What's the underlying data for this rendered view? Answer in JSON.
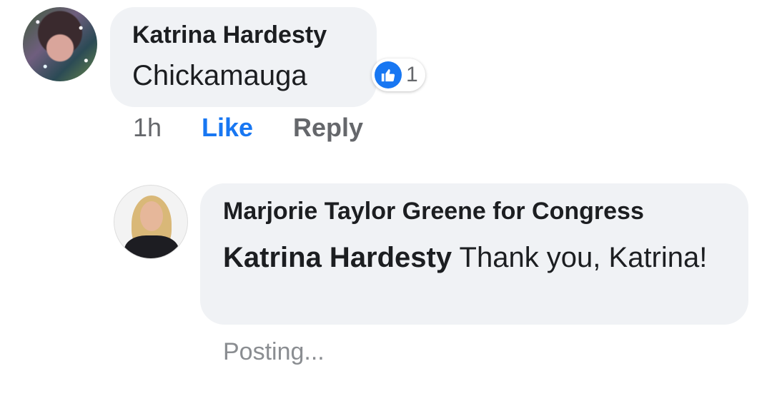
{
  "comment": {
    "author": "Katrina Hardesty",
    "text": "Chickamauga",
    "reaction": {
      "icon": "thumbs-up-icon",
      "count": "1",
      "color": "#1877f2"
    },
    "actions": {
      "time": "1h",
      "like": "Like",
      "reply": "Reply"
    }
  },
  "reply": {
    "author": "Marjorie Taylor Greene for Congress",
    "mention": "Katrina Hardesty",
    "text": " Thank you, Katrina!",
    "status": "Posting..."
  },
  "colors": {
    "bubble": "#f0f2f5",
    "link_active": "#1877f2",
    "muted": "#65676b"
  }
}
